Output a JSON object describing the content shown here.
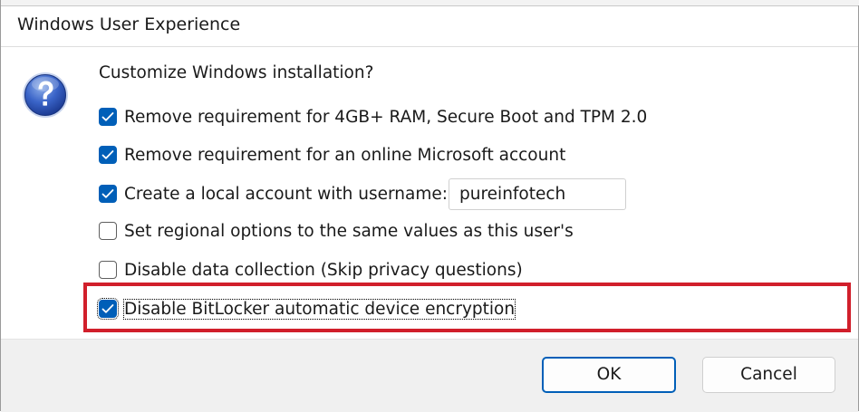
{
  "window": {
    "title": "Windows User Experience"
  },
  "dialog": {
    "icon": "question-icon",
    "prompt": "Customize Windows installation?",
    "options": [
      {
        "label": "Remove requirement for 4GB+ RAM, Secure Boot and TPM 2.0",
        "checked": true
      },
      {
        "label": "Remove requirement for an online Microsoft account",
        "checked": true
      },
      {
        "label": "Create a local account with username:",
        "checked": true
      },
      {
        "label": "Set regional options to the same values as this user's",
        "checked": false
      },
      {
        "label": "Disable data collection (Skip privacy questions)",
        "checked": false
      },
      {
        "label": "Disable BitLocker automatic device encryption",
        "checked": true
      }
    ],
    "username": {
      "value": "pureinfotech"
    },
    "highlight_color": "#d11f2b",
    "accent_color": "#005fb8"
  },
  "buttons": {
    "ok_label": "OK",
    "cancel_label": "Cancel"
  }
}
